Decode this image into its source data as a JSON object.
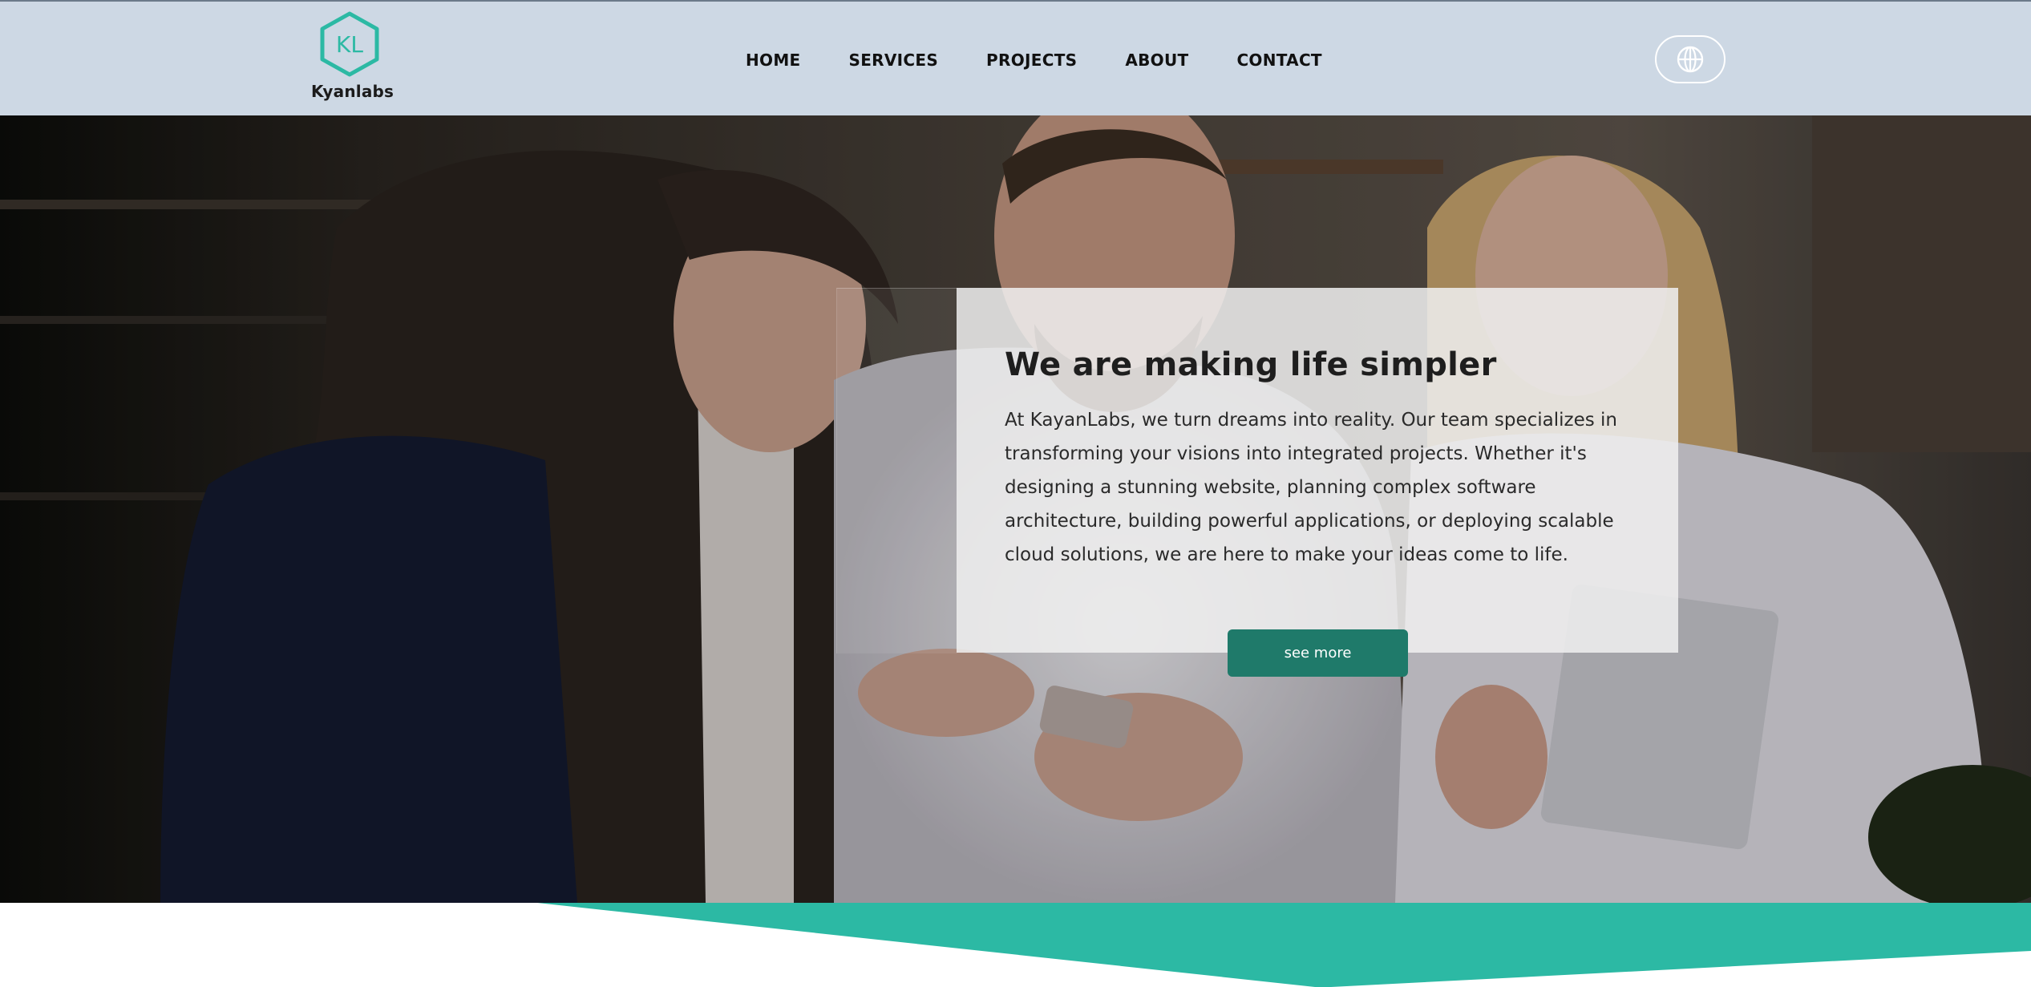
{
  "header": {
    "logo": {
      "mark_text": "KL",
      "name": "Kyanlabs",
      "icon": "hexagon-logo-icon",
      "color": "#2cb9a4"
    },
    "nav": {
      "home": "HOME",
      "services": "SERVICES",
      "projects": "PROJECTS",
      "about": "ABOUT",
      "contact": "CONTACT"
    },
    "language_button": {
      "icon": "globe-icon"
    },
    "background": "#cdd8e4"
  },
  "hero": {
    "title": "We are making life simpler",
    "description": "At KayanLabs, we turn dreams into reality. Our team specializes in transforming your visions into integrated projects. Whether it's designing a stunning website, planning complex software architecture, building powerful applications, or deploying scalable cloud solutions, we are here to make your ideas come to life.",
    "cta_label": "see more",
    "cta_color": "#1f7a6a"
  },
  "colors": {
    "accent": "#2cb9a4",
    "header_bg": "#cdd8e4"
  }
}
